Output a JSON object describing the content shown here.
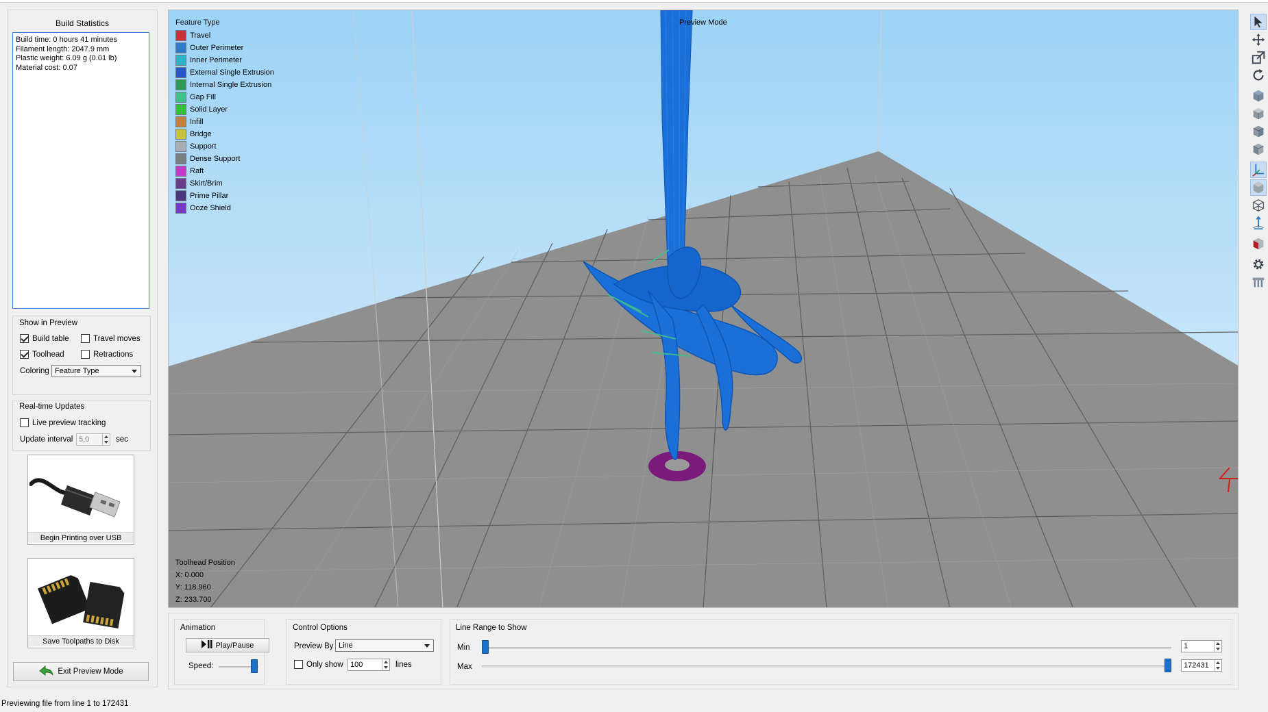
{
  "build_statistics": {
    "title": "Build Statistics",
    "lines": [
      "Build time: 0 hours 41 minutes",
      "Filament length: 2047.9 mm",
      "Plastic weight: 6.09 g (0.01 lb)",
      "Material cost: 0.07"
    ]
  },
  "show_in_preview": {
    "title": "Show in Preview",
    "build_table": {
      "label": "Build table",
      "checked": true
    },
    "travel_moves": {
      "label": "Travel moves",
      "checked": false
    },
    "toolhead": {
      "label": "Toolhead",
      "checked": true
    },
    "retractions": {
      "label": "Retractions",
      "checked": false
    },
    "coloring_label": "Coloring",
    "coloring_value": "Feature Type"
  },
  "realtime_updates": {
    "title": "Real-time Updates",
    "live_tracking": {
      "label": "Live preview tracking",
      "checked": false
    },
    "interval_label": "Update interval",
    "interval_value": "5,0",
    "interval_unit": "sec"
  },
  "usb_button": {
    "label": "Begin Printing over USB",
    "icon": "usb-cable-icon"
  },
  "disk_button": {
    "label": "Save Toolpaths to Disk",
    "icon": "sd-card-icon"
  },
  "exit_button": {
    "label": "Exit Preview Mode",
    "icon": "back-arrow-icon",
    "icon_color": "#3a9d3a"
  },
  "viewport": {
    "mode_label": "Preview Mode",
    "legend_title": "Feature Type",
    "legend": [
      {
        "label": "Travel",
        "color": "#c8303a"
      },
      {
        "label": "Outer Perimeter",
        "color": "#2f7ac8"
      },
      {
        "label": "Inner Perimeter",
        "color": "#2fb3c8"
      },
      {
        "label": "External Single Extrusion",
        "color": "#2b58c8"
      },
      {
        "label": "Internal Single Extrusion",
        "color": "#2f9a56"
      },
      {
        "label": "Gap Fill",
        "color": "#3fc08a"
      },
      {
        "label": "Solid Layer",
        "color": "#36c03a"
      },
      {
        "label": "Infill",
        "color": "#c4803a"
      },
      {
        "label": "Bridge",
        "color": "#c8c43a"
      },
      {
        "label": "Support",
        "color": "#a9adb4"
      },
      {
        "label": "Dense Support",
        "color": "#7b7f86"
      },
      {
        "label": "Raft",
        "color": "#c43ac8"
      },
      {
        "label": "Skirt/Brim",
        "color": "#6a3a8c"
      },
      {
        "label": "Prime Pillar",
        "color": "#4a3a7c"
      },
      {
        "label": "Ooze Shield",
        "color": "#7a3ac8"
      }
    ],
    "toolhead_title": "Toolhead Position",
    "toolhead_x": "X: 0.000",
    "toolhead_y": "Y: 118.960",
    "toolhead_z": "Z: 233.700",
    "model_color": "#1a6fd8",
    "brim_color": "#7a1a7a"
  },
  "animation": {
    "title": "Animation",
    "play_label": "Play/Pause",
    "speed_label": "Speed:",
    "speed_level": 0.9
  },
  "control_options": {
    "title": "Control Options",
    "preview_by_label": "Preview By",
    "preview_by_value": "Line",
    "only_show": {
      "label": "Only show",
      "checked": false
    },
    "lines_value": "100",
    "lines_unit": "lines"
  },
  "line_range": {
    "title": "Line Range to Show",
    "min_label": "Min",
    "max_label": "Max",
    "min_value": "1",
    "max_value": "172431",
    "total_lines": 172431
  },
  "status": "Previewing file from line 1 to 172431",
  "toolbar": [
    "select-arrow-icon",
    "move-icon",
    "scale-icon",
    "rotate-icon",
    "view-front-icon",
    "view-top-icon",
    "view-side-icon",
    "view-iso-icon",
    "axes-icon",
    "solid-view-icon",
    "wireframe-icon",
    "normals-icon",
    "cut-icon",
    "settings-gear-icon",
    "supports-icon"
  ]
}
